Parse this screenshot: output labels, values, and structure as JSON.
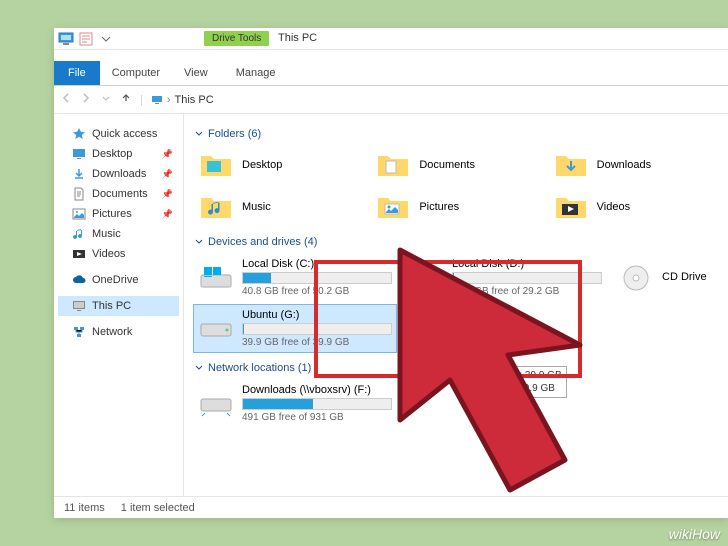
{
  "qat": {
    "title": "This PC"
  },
  "ribbon": {
    "file": "File",
    "computer": "Computer",
    "view": "View",
    "ctx_group": "Drive Tools",
    "manage": "Manage"
  },
  "breadcrumb": {
    "location": "This PC"
  },
  "nav": {
    "quick": "Quick access",
    "desktop": "Desktop",
    "downloads": "Downloads",
    "documents": "Documents",
    "pictures": "Pictures",
    "music": "Music",
    "videos": "Videos",
    "onedrive": "OneDrive",
    "thispc": "This PC",
    "network": "Network"
  },
  "sections": {
    "folders": "Folders (6)",
    "devices": "Devices and drives (4)",
    "network": "Network locations (1)"
  },
  "folders": {
    "desktop": "Desktop",
    "documents": "Documents",
    "downloads": "Downloads",
    "music": "Music",
    "pictures": "Pictures",
    "videos": "Videos"
  },
  "drives": {
    "c": {
      "name": "Local Disk (C:)",
      "free": "40.8 GB free of 50.2 GB",
      "pct": 19
    },
    "d": {
      "name": "Local Disk (D:)",
      "free": "29.2 GB free of 29.2 GB",
      "pct": 1
    },
    "cd": {
      "name": "CD Drive"
    },
    "g": {
      "name": "Ubuntu (G:)",
      "free": "39.9 GB free of 39.9 GB",
      "pct": 1
    }
  },
  "netloc": {
    "name": "Downloads (\\\\vboxsrv) (F:)",
    "free": "491 GB free of 931 GB",
    "pct": 47
  },
  "tooltip": {
    "l1": "Space free: 39.9 GB",
    "l2": "Total size: 39.9 GB"
  },
  "status": {
    "items": "11 items",
    "selected": "1 item selected"
  },
  "watermark": "wikiHow"
}
